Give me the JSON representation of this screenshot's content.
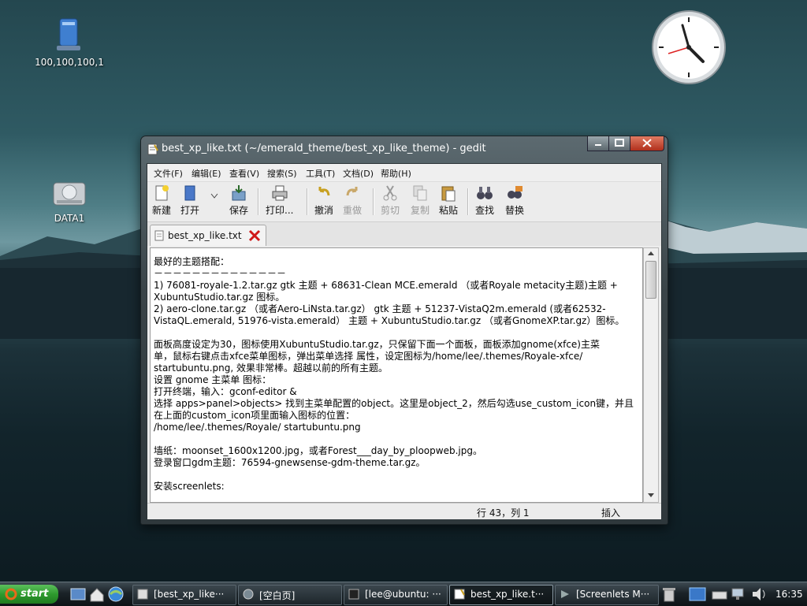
{
  "desktop": {
    "icons": [
      {
        "label": "100,100,100,1",
        "icon": "network-share-icon"
      },
      {
        "label": "DATA1",
        "icon": "hard-drive-icon"
      }
    ]
  },
  "window": {
    "title": "best_xp_like.txt (~/emerald_theme/best_xp_like_theme) - gedit",
    "menus": [
      "文件(F)",
      "编辑(E)",
      "查看(V)",
      "搜索(S)",
      "工具(T)",
      "文档(D)",
      "帮助(H)"
    ],
    "toolbar": {
      "new": "新建",
      "open": "打开",
      "save": "保存",
      "print": "打印...",
      "undo": "撤消",
      "redo": "重做",
      "cut": "剪切",
      "copy": "复制",
      "paste": "粘贴",
      "find": "查找",
      "replace": "替换"
    },
    "tab": {
      "label": "best_xp_like.txt"
    },
    "content_lines": [
      "最好的主题搭配：",
      "－－－－－－－－－－－－－－",
      "1) 76081-royale-1.2.tar.gz gtk 主题 + 68631-Clean MCE.emerald （或者Royale metacity主题)主题 +",
      "XubuntuStudio.tar.gz 图标。",
      "2) aero-clone.tar.gz （或者Aero-LiNsta.tar.gz） gtk 主题 + 51237-VistaQ2m.emerald (或者62532-",
      "VistaQL.emerald, 51976-vista.emerald） 主题 + XubuntuStudio.tar.gz （或者GnomeXP.tar.gz）图标。",
      "",
      "面板高度设定为30，图标使用XubuntuStudio.tar.gz，只保留下面一个面板，面板添加gnome(xfce)主菜",
      "单，鼠标右键点击xfce菜单图标，弹出菜单选择 属性，设定图标为/home/lee/.themes/Royale-xfce/",
      "startubuntu.png, 效果非常棒。超越以前的所有主题。",
      "设置 gnome 主菜单 图标：",
      "打开终端，输入：gconf-editor &",
      "选择 apps>panel>objects> 找到主菜单配置的object。这里是object_2，然后勾选use_custom_icon键，并且",
      "在上面的custom_icon项里面输入图标的位置：",
      "/home/lee/.themes/Royale/ startubuntu.png",
      "",
      "墙纸：moonset_1600x1200.jpg，或者Forest___day_by_ploopweb.jpg。",
      "登录窗口gdm主题：76594-gnewsense-gdm-theme.tar.gz。",
      "",
      "安装screenlets:"
    ],
    "status": {
      "position": "行 43，列 1",
      "mode": "插入"
    }
  },
  "taskbar": {
    "start_label": "start",
    "tasks": [
      {
        "label": "[best_xp_like···",
        "active": false
      },
      {
        "label": "[空白页]",
        "active": false
      },
      {
        "label": "[lee@ubuntu: ···",
        "active": false
      },
      {
        "label": "best_xp_like.t···",
        "active": true
      },
      {
        "label": "[Screenlets M···",
        "active": false
      }
    ],
    "time": "16:35"
  }
}
